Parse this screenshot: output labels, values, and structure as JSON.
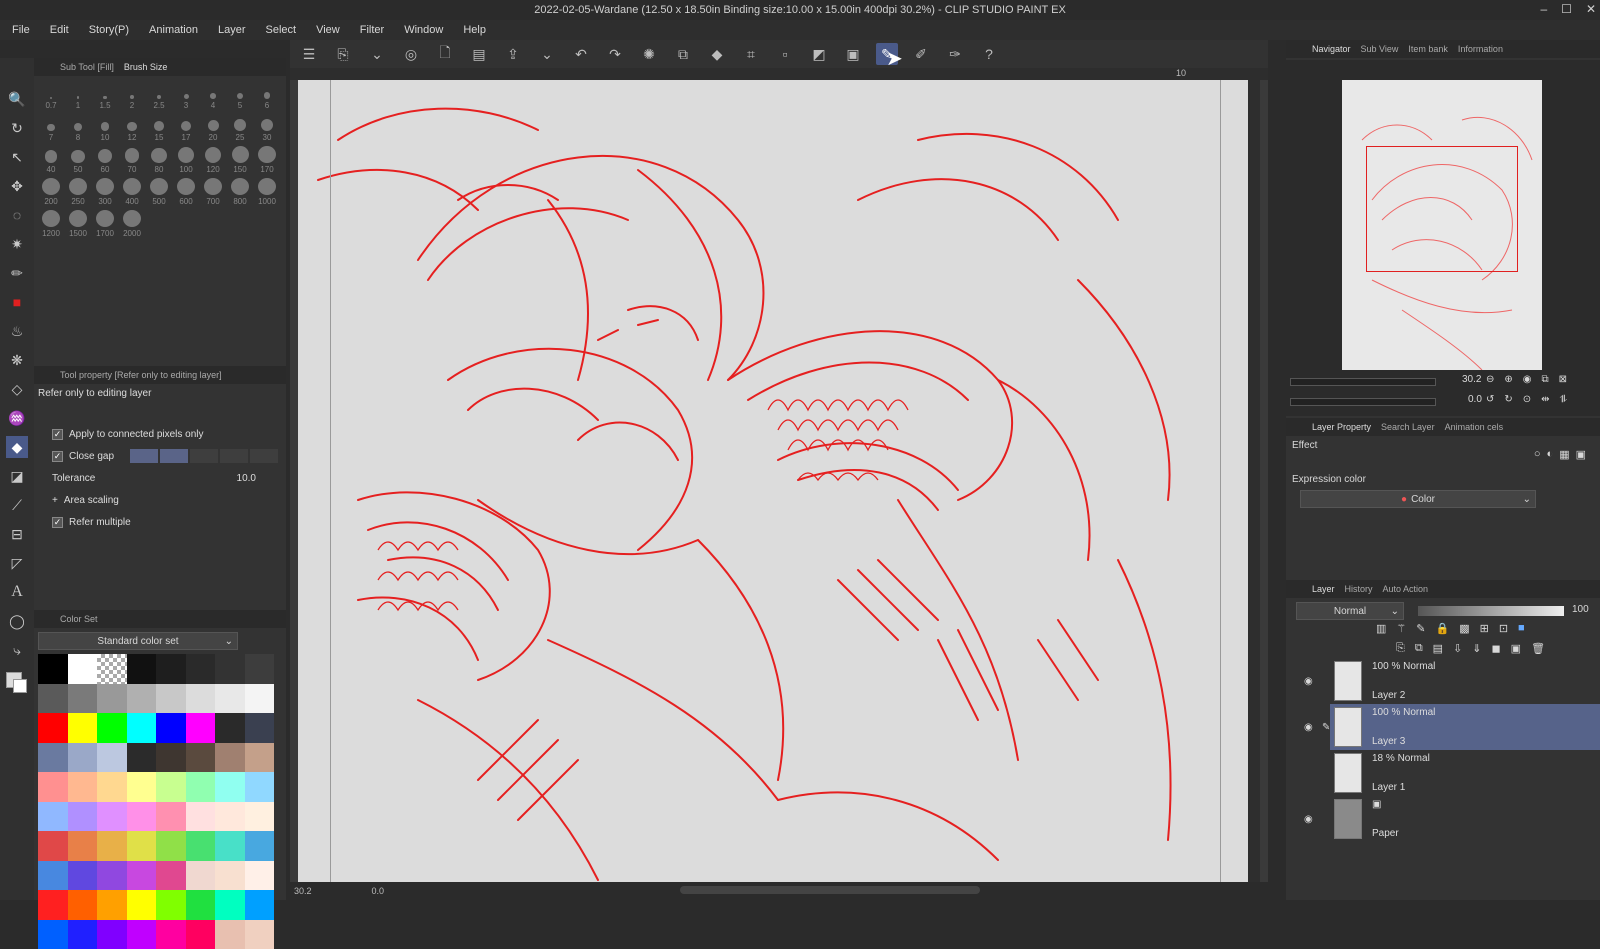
{
  "window": {
    "title": "2022-02-05-Wardane (12.50 x 18.50in Binding size:10.00 x 15.00in 400dpi 30.2%) - CLIP STUDIO PAINT EX"
  },
  "menu": [
    "File",
    "Edit",
    "Story(P)",
    "Animation",
    "Layer",
    "Select",
    "View",
    "Filter",
    "Window",
    "Help"
  ],
  "left_panel": {
    "tabs": [
      "Sub Tool [Fill]",
      "Brush Size"
    ],
    "brush_sizes": [
      "0.7",
      "1",
      "1.5",
      "2",
      "2.5",
      "3",
      "4",
      "5",
      "6",
      "7",
      "8",
      "10",
      "12",
      "15",
      "17",
      "20",
      "25",
      "30",
      "40",
      "50",
      "60",
      "70",
      "80",
      "100",
      "120",
      "150",
      "170",
      "200",
      "250",
      "300",
      "400",
      "500",
      "600",
      "700",
      "800",
      "1000",
      "1200",
      "1500",
      "1700",
      "2000"
    ],
    "tool_property_title": "Tool property [Refer only to editing layer]",
    "refer_label": "Refer only to editing layer",
    "apply_connected": "Apply to connected pixels only",
    "close_gap": "Close gap",
    "tolerance_label": "Tolerance",
    "tolerance_value": "10.0",
    "area_scaling": "Area scaling",
    "refer_multiple": "Refer multiple",
    "color_set_tab": "Color Set",
    "color_set_name": "Standard color set"
  },
  "swatches": [
    "#000000",
    "#ffffff",
    "checker",
    "#111111",
    "#1e1e1e",
    "#2a2a2a",
    "#333333",
    "#3d3d3d",
    "#5a5a5a",
    "#7a7a7a",
    "#999999",
    "#b0b0b0",
    "#c8c8c8",
    "#dcdcdc",
    "#e8e8e8",
    "#f4f4f4",
    "#ff0000",
    "#ffff00",
    "#00ff00",
    "#00ffff",
    "#0000ff",
    "#ff00ff",
    "#2a2a2a",
    "#3a4050",
    "#6a7aa0",
    "#9aa8c8",
    "#bcc8e0",
    "#2b2b2b",
    "#3e3630",
    "#5a4a3e",
    "#a08070",
    "#c4a08a",
    "#ff9090",
    "#ffb890",
    "#ffd890",
    "#ffff90",
    "#c8ff90",
    "#90ffb0",
    "#90fff0",
    "#90d8ff",
    "#90b8ff",
    "#b090ff",
    "#e090ff",
    "#ff90e8",
    "#ff90b0",
    "#ffe0e0",
    "#ffe8dc",
    "#fff0e0",
    "#e04848",
    "#e88048",
    "#e8b048",
    "#e0e048",
    "#90e048",
    "#48e070",
    "#48e0c8",
    "#48a8e0",
    "#4888e0",
    "#6048e0",
    "#9048e0",
    "#c848e0",
    "#e04890",
    "#f0d8d0",
    "#f8e0d0",
    "#fff0e8",
    "#ff2020",
    "#ff6000",
    "#ffa000",
    "#ffff00",
    "#80ff00",
    "#20e040",
    "#00ffc0",
    "#00a0ff",
    "#0060ff",
    "#2020ff",
    "#8000ff",
    "#c000ff",
    "#ff00a0",
    "#ff0060",
    "#e8c0b0",
    "#f0d0c0"
  ],
  "toolbar_icons": [
    "menu-icon",
    "new-canvas-icon",
    "chevron-down-icon",
    "stamp-icon",
    "new-file-icon",
    "open-folder-icon",
    "export-icon",
    "chevron-down-icon",
    "undo-icon",
    "redo-icon",
    "loading-icon",
    "copy-icon",
    "fill-icon",
    "crop-icon",
    "blank-icon",
    "blank-icon",
    "blank-icon",
    "pen-active-icon",
    "brush-icon",
    "ruler-pen-icon",
    "help-icon"
  ],
  "canvas": {
    "ruler_mark": "10",
    "side_ruler_mark": "10"
  },
  "navigator": {
    "tabs": [
      "Navigator",
      "Sub View",
      "Item bank",
      "Information"
    ],
    "zoom": "30.2",
    "rotate": "0.0"
  },
  "layer_property": {
    "tabs": [
      "Layer Property",
      "Search Layer",
      "Animation cels"
    ],
    "effect_label": "Effect",
    "expression_label": "Expression color",
    "expression_value": "Color"
  },
  "layer_panel": {
    "tabs": [
      "Layer",
      "History",
      "Auto Action"
    ],
    "blend_mode": "Normal",
    "opacity": "100",
    "layers": [
      {
        "mode": "100 % Normal",
        "name": "Layer 2",
        "selected": false,
        "visible": true
      },
      {
        "mode": "100 % Normal",
        "name": "Layer 3",
        "selected": true,
        "visible": true
      },
      {
        "mode": "18 % Normal",
        "name": "Layer 1",
        "selected": false,
        "visible": false
      },
      {
        "mode": "",
        "name": "Paper",
        "selected": false,
        "visible": true
      }
    ]
  },
  "status": {
    "zoom": "30.2",
    "rotation": "0.0"
  }
}
